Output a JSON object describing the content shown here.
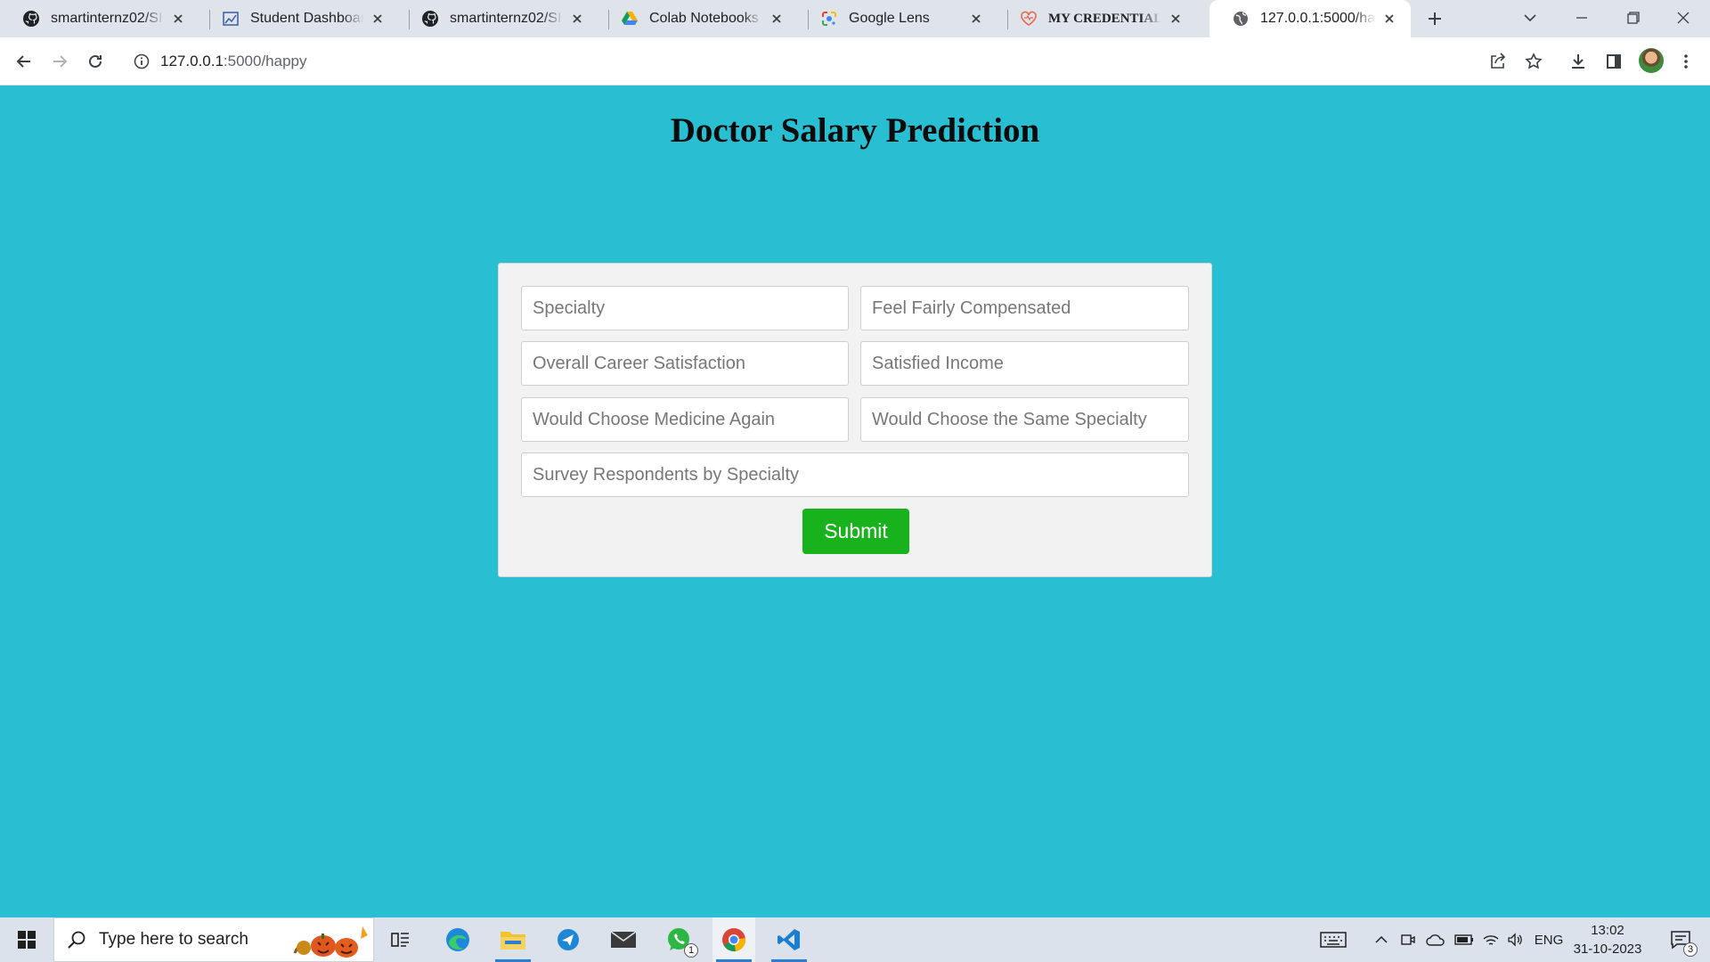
{
  "browser": {
    "tabs": [
      {
        "title": "smartinternz02/SI-GuidedProject",
        "icon": "github-icon",
        "active": false
      },
      {
        "title": "Student Dashboard",
        "icon": "dashboard-icon",
        "active": false
      },
      {
        "title": "smartinternz02/SI-GuidedProject",
        "icon": "github-icon",
        "active": false
      },
      {
        "title": "Colab Notebooks - Google Drive",
        "icon": "google-drive-icon",
        "active": false
      },
      {
        "title": "Google Lens",
        "icon": "google-lens-icon",
        "active": false
      },
      {
        "title": "MY CREDENTIALS & CERTIFICATES",
        "icon": "heart-icon",
        "active": false
      },
      {
        "title": "127.0.0.1:5000/happy",
        "icon": "globe-icon",
        "active": true
      }
    ],
    "url_host": "127.0.0.1",
    "url_path": ":5000/happy"
  },
  "page": {
    "title": "Doctor Salary Prediction",
    "fields": {
      "specialty": "Specialty",
      "feel_fairly_compensated": "Feel Fairly Compensated",
      "overall_career_satisfaction": "Overall Career Satisfaction",
      "satisfied_income": "Satisfied Income",
      "would_choose_medicine_again": "Would Choose Medicine Again",
      "would_choose_same_specialty": "Would Choose the Same Specialty",
      "survey_respondents_by_specialty": "Survey Respondents by Specialty"
    },
    "submit_label": "Submit"
  },
  "taskbar": {
    "search_placeholder": "Type here to search",
    "language": "ENG",
    "time": "13:02",
    "date": "31-10-2023",
    "whatsapp_badge": "1",
    "notification_badge": "3"
  },
  "colors": {
    "page_background": "#29bfd3",
    "card_background": "#f2f2f2",
    "submit_button": "#17b21c",
    "tabstrip": "#dfe4ea"
  }
}
